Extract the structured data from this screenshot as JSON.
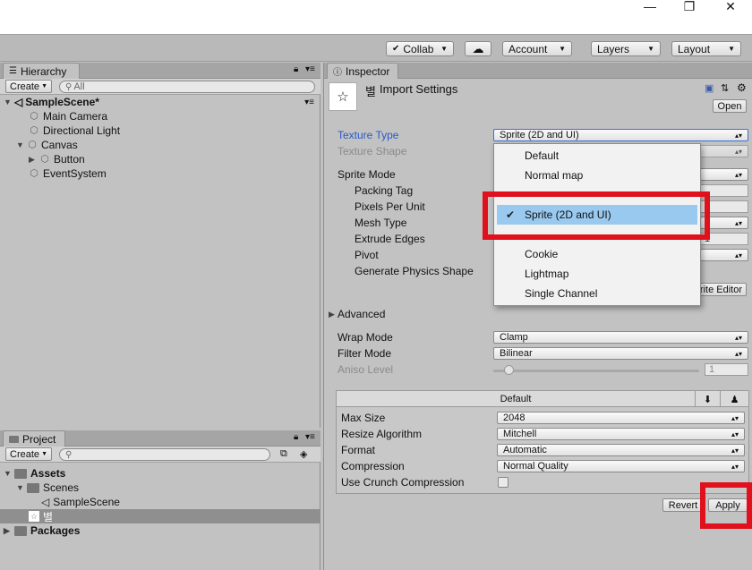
{
  "window": {
    "minimize_icon": "—",
    "restore_icon": "❐",
    "close_icon": "✕"
  },
  "toolbar": {
    "collab_label": "Collab",
    "account_label": "Account",
    "layers_label": "Layers",
    "layout_label": "Layout"
  },
  "hierarchy": {
    "tab_label": "Hierarchy",
    "create_label": "Create",
    "search_placeholder": "All",
    "scene_name": "SampleScene*",
    "items": [
      {
        "label": "Main Camera"
      },
      {
        "label": "Directional Light"
      },
      {
        "label": "Canvas"
      },
      {
        "label": "Button"
      },
      {
        "label": "EventSystem"
      }
    ]
  },
  "project": {
    "tab_label": "Project",
    "create_label": "Create",
    "items": [
      {
        "label": "Assets"
      },
      {
        "label": "Scenes"
      },
      {
        "label": "SampleScene"
      },
      {
        "label": "별"
      },
      {
        "label": "Packages"
      }
    ]
  },
  "inspector": {
    "tab_label": "Inspector",
    "asset_glyph": "☆",
    "title_prefix": "별",
    "title": "Import Settings",
    "open_label": "Open",
    "texture_type_label": "Texture Type",
    "texture_type_value": "Sprite (2D and UI)",
    "texture_shape_label": "Texture Shape",
    "sprite_mode_label": "Sprite Mode",
    "packing_tag_label": "Packing Tag",
    "pixels_per_unit_label": "Pixels Per Unit",
    "mesh_type_label": "Mesh Type",
    "extrude_edges_label": "Extrude Edges",
    "extrude_value": "1",
    "pivot_label": "Pivot",
    "generate_physics_label": "Generate Physics Shape",
    "sprite_editor_label": "Sprite Editor",
    "advanced_label": "Advanced",
    "wrap_mode_label": "Wrap Mode",
    "wrap_mode_value": "Clamp",
    "filter_mode_label": "Filter Mode",
    "filter_mode_value": "Bilinear",
    "aniso_label": "Aniso Level",
    "aniso_value": "1",
    "platform_tab_label": "Default",
    "max_size_label": "Max Size",
    "max_size_value": "2048",
    "resize_label": "Resize Algorithm",
    "resize_value": "Mitchell",
    "format_label": "Format",
    "format_value": "Automatic",
    "compression_label": "Compression",
    "compression_value": "Normal Quality",
    "crunch_label": "Use Crunch Compression",
    "revert_label": "Revert",
    "apply_label": "Apply"
  },
  "popup_menu": {
    "items": [
      {
        "label": "Default"
      },
      {
        "label": "Normal map"
      },
      {
        "label": "Sprite (2D and UI)",
        "selected": true
      },
      {
        "label": "Cookie"
      },
      {
        "label": "Lightmap"
      },
      {
        "label": "Single Channel"
      }
    ]
  },
  "colors": {
    "highlight_box": "#e0101c",
    "selected_item": "#99c9ef",
    "focused_label": "#2a59c8"
  }
}
